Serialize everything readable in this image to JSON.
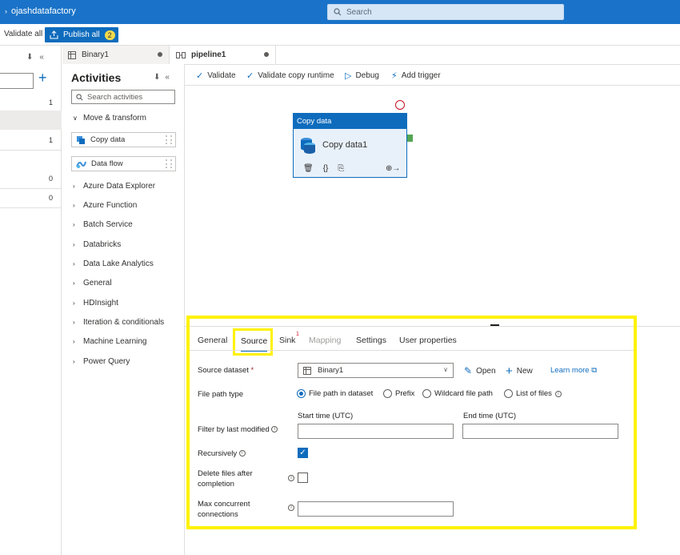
{
  "topbar": {
    "factory_name": "ojashdatafactory",
    "search_placeholder": "Search"
  },
  "toolbar": {
    "validate_all": "Validate all",
    "publish_all": "Publish all",
    "publish_count": "2"
  },
  "left_panel": {
    "counts": [
      "1",
      "1",
      "0",
      "0"
    ]
  },
  "tabs": {
    "binary": "Binary1",
    "pipeline": "pipeline1"
  },
  "activities": {
    "title": "Activities",
    "search_placeholder": "Search activities",
    "expanded_category": "Move & transform",
    "items": [
      "Copy data",
      "Data flow"
    ],
    "categories": [
      "Azure Data Explorer",
      "Azure Function",
      "Batch Service",
      "Databricks",
      "Data Lake Analytics",
      "General",
      "HDInsight",
      "Iteration & conditionals",
      "Machine Learning",
      "Power Query"
    ]
  },
  "canvas_toolbar": {
    "validate": "Validate",
    "validate_copy_runtime": "Validate copy runtime",
    "debug": "Debug",
    "add_trigger": "Add trigger"
  },
  "node": {
    "header": "Copy data",
    "name": "Copy data1"
  },
  "properties": {
    "tabs": {
      "general": "General",
      "source": "Source",
      "sink": "Sink",
      "sink_badge": "1",
      "mapping": "Mapping",
      "settings": "Settings",
      "user_properties": "User properties"
    },
    "source_dataset_label": "Source dataset",
    "required_mark": "*",
    "source_dataset_value": "Binary1",
    "open": "Open",
    "new": "New",
    "learn_more": "Learn more",
    "file_path_type_label": "File path type",
    "file_path_options": [
      "File path in dataset",
      "Prefix",
      "Wildcard file path",
      "List of files"
    ],
    "filter_label": "Filter by last modified",
    "start_time_label": "Start time (UTC)",
    "end_time_label": "End time (UTC)",
    "recursively_label": "Recursively",
    "recursively_checked": true,
    "delete_files_label_1": "Delete files after",
    "delete_files_label_2": "completion",
    "max_concurrent_label_1": "Max concurrent",
    "max_concurrent_label_2": "connections"
  }
}
